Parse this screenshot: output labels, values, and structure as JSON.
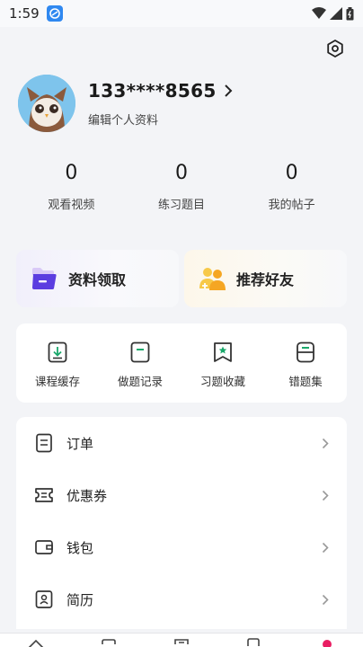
{
  "status_bar": {
    "time": "1:59",
    "app_badge": "App"
  },
  "profile": {
    "phone": "133****8565",
    "edit_label": "编辑个人资料"
  },
  "stats": [
    {
      "value": "0",
      "label": "观看视频"
    },
    {
      "value": "0",
      "label": "练习题目"
    },
    {
      "value": "0",
      "label": "我的帖子"
    }
  ],
  "promos": [
    {
      "label": "资料领取",
      "icon": "folder-icon"
    },
    {
      "label": "推荐好友",
      "icon": "friends-icon"
    }
  ],
  "tools": [
    {
      "label": "课程缓存",
      "icon": "download-icon"
    },
    {
      "label": "做题记录",
      "icon": "record-icon"
    },
    {
      "label": "习题收藏",
      "icon": "bookmark-star-icon"
    },
    {
      "label": "错题集",
      "icon": "wrong-set-icon"
    }
  ],
  "menu": [
    {
      "label": "订单",
      "icon": "order-icon"
    },
    {
      "label": "优惠券",
      "icon": "coupon-icon"
    },
    {
      "label": "钱包",
      "icon": "wallet-icon"
    },
    {
      "label": "简历",
      "icon": "resume-icon"
    }
  ],
  "colors": {
    "accent": "#e91e63",
    "folder": "#5b3de0",
    "friends": "#f5a623",
    "avatar_bg": "#7ec4ec"
  }
}
